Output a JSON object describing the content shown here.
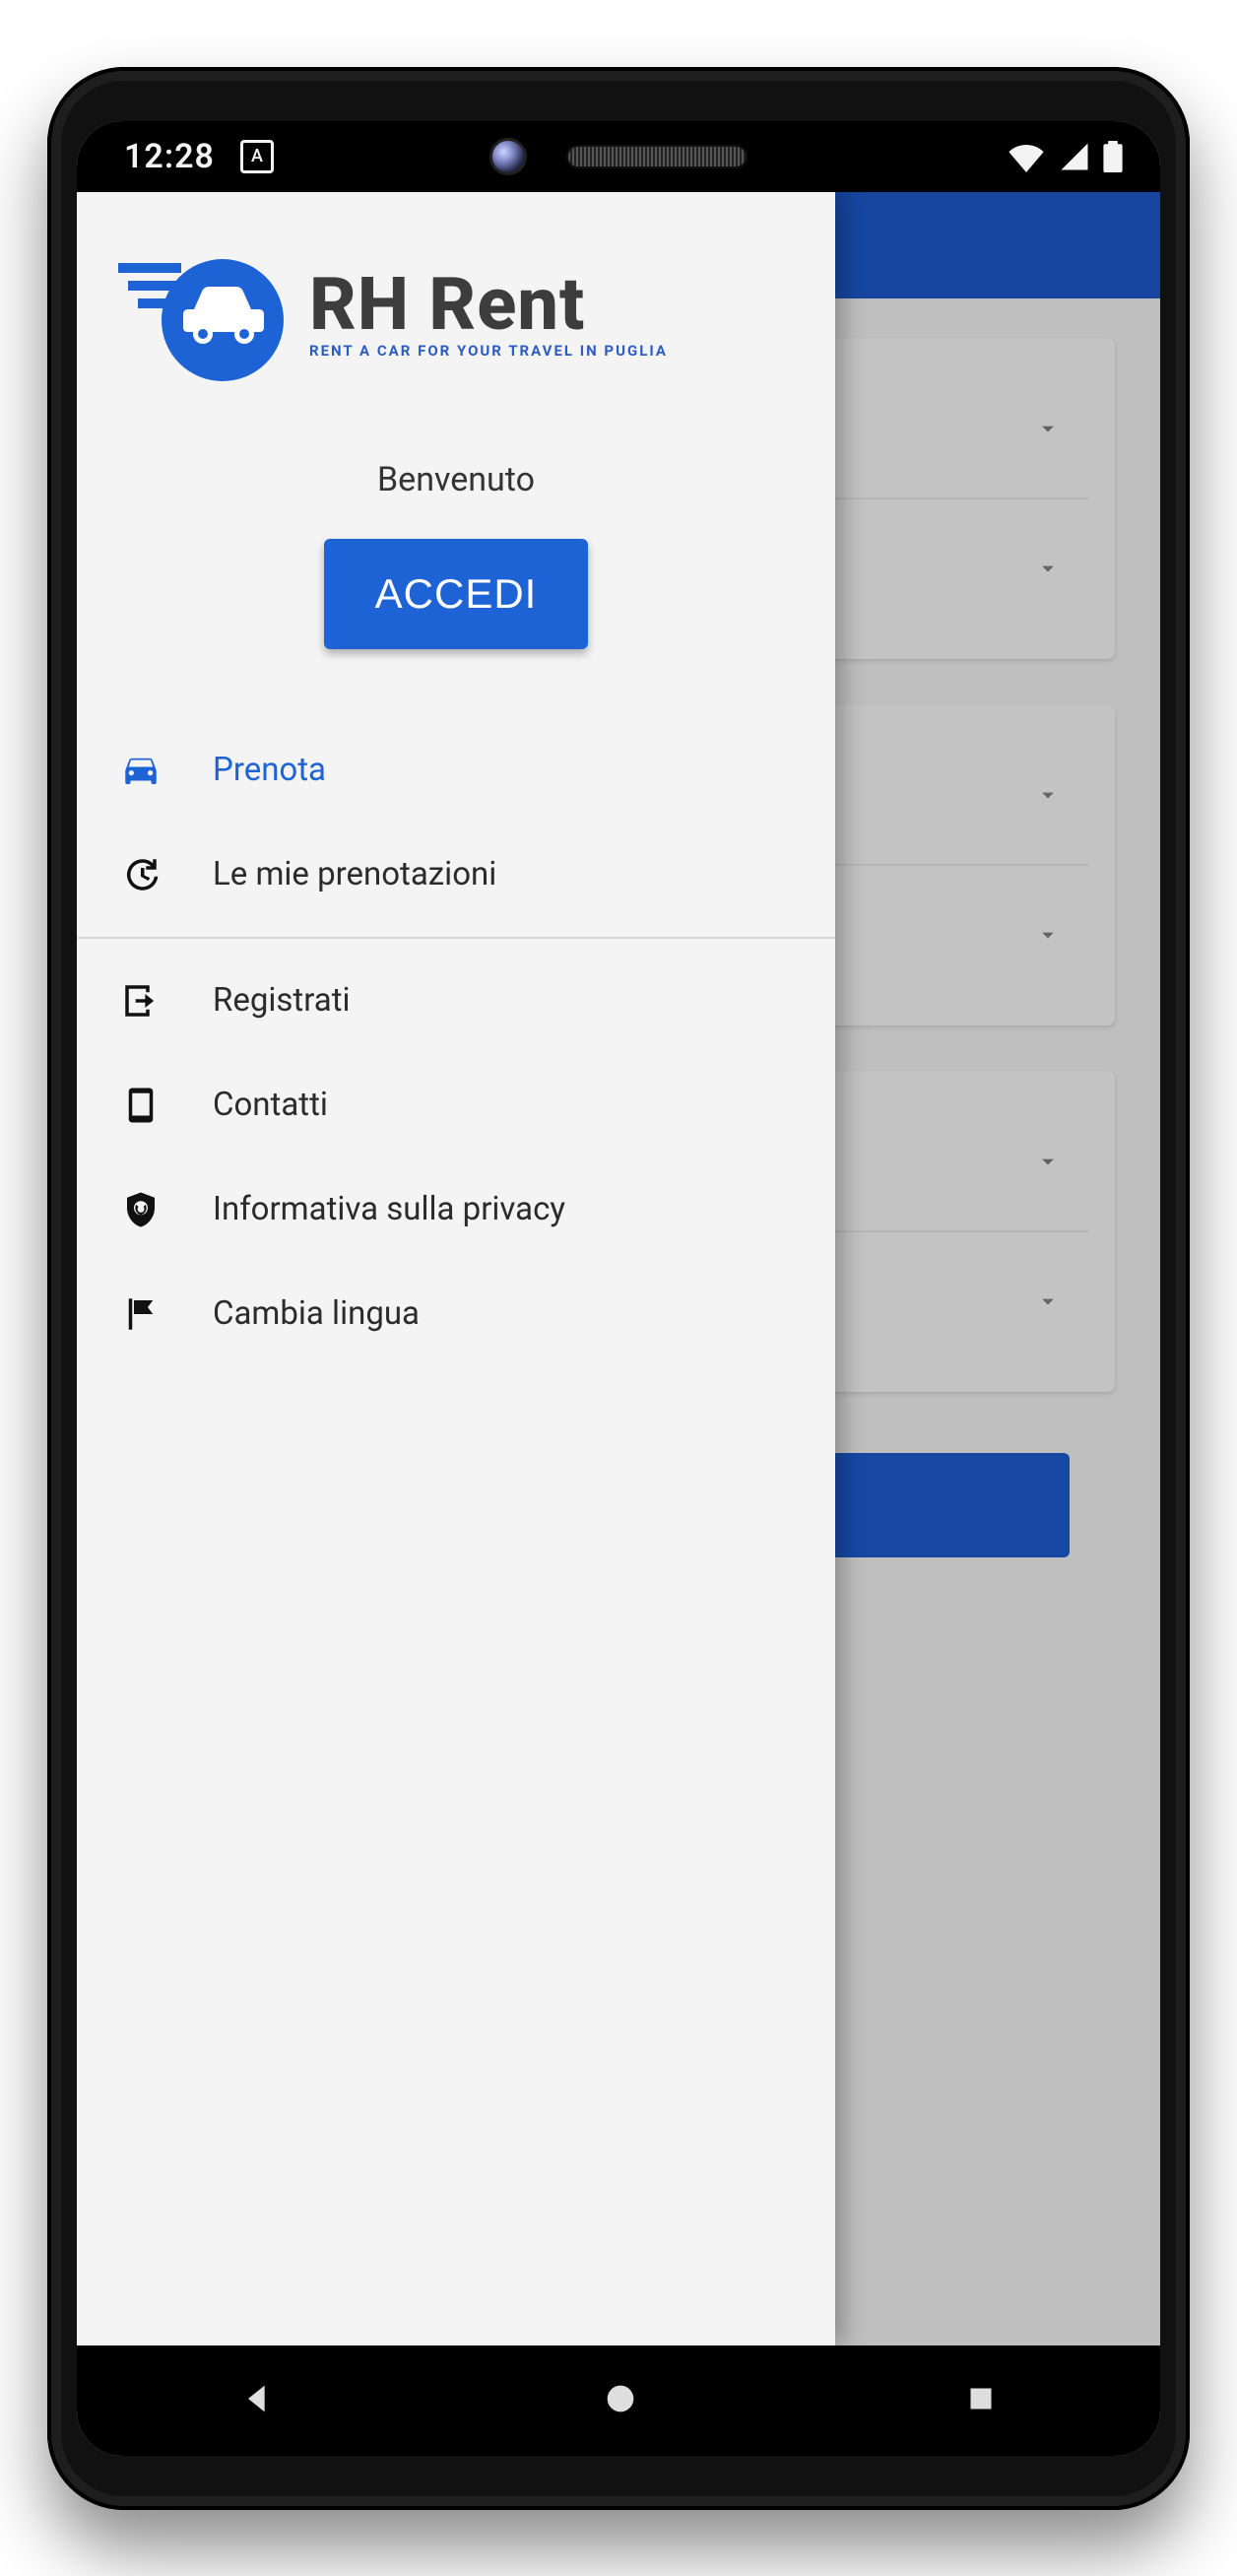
{
  "status": {
    "time": "12:28",
    "indicator_letter": "A"
  },
  "logo": {
    "title": "RH Rent",
    "tagline": "RENT A CAR FOR YOUR TRAVEL IN PUGLIA"
  },
  "drawer": {
    "welcome": "Benvenuto",
    "login_button": "ACCEDI",
    "items": [
      {
        "label": "Prenota",
        "icon": "car-icon",
        "active": true
      },
      {
        "label": "Le mie prenotazioni",
        "icon": "history-icon",
        "active": false
      },
      {
        "label": "Registrati",
        "icon": "signup-icon",
        "active": false
      },
      {
        "label": "Contatti",
        "icon": "phone-icon",
        "active": false
      },
      {
        "label": "Informativa sulla privacy",
        "icon": "privacy-icon",
        "active": false
      },
      {
        "label": "Cambia lingua",
        "icon": "flag-icon",
        "active": false
      }
    ]
  },
  "colors": {
    "primary": "#1e63d6",
    "header": "#1c56c4"
  }
}
